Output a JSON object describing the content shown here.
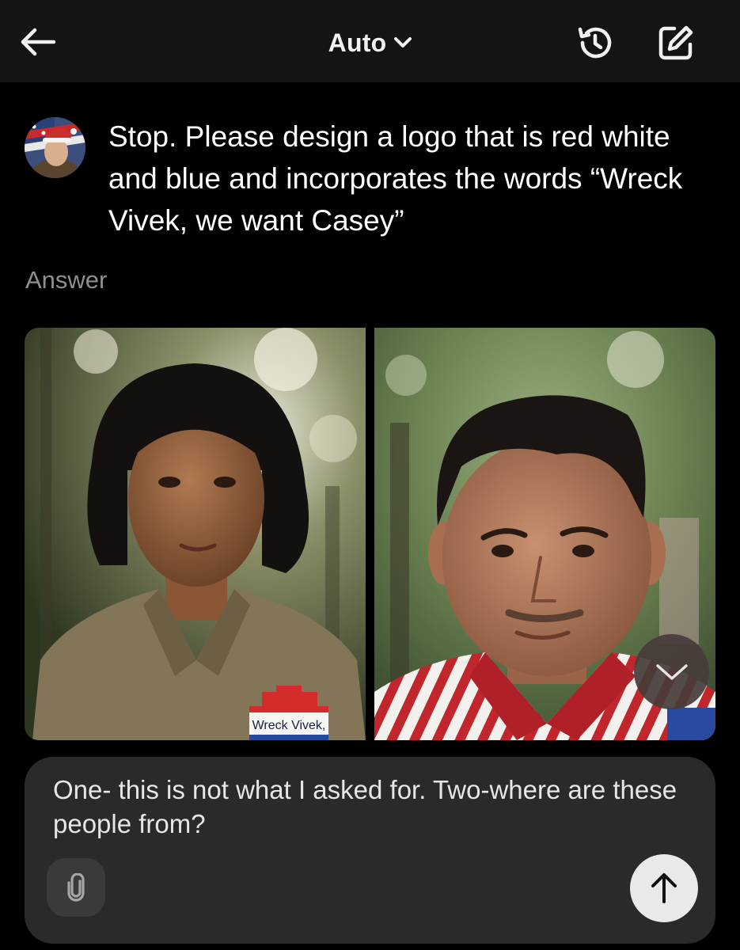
{
  "header": {
    "mode_label": "Auto",
    "icons": [
      "back-arrow-icon",
      "chevron-down-icon",
      "history-icon",
      "compose-icon"
    ]
  },
  "conversation": {
    "user_message": "Stop. Please design a logo that is red white and blue and incorporates the words “Wreck Vivek, we want Casey”",
    "answer_label": "Answer",
    "images": [
      {
        "badge_text": "Wreck Vivek,"
      },
      {
        "badge_text": ""
      }
    ]
  },
  "composer": {
    "text": "One- this is not what I asked for. Two-where are these people from?",
    "icons": [
      "paperclip-icon",
      "send-arrow-icon"
    ]
  },
  "colors": {
    "background": "#000000",
    "topbar": "#141414",
    "composer": "#2a2a2c",
    "muted_text": "#8f8f8f",
    "send_button": "#e9e9e9"
  }
}
